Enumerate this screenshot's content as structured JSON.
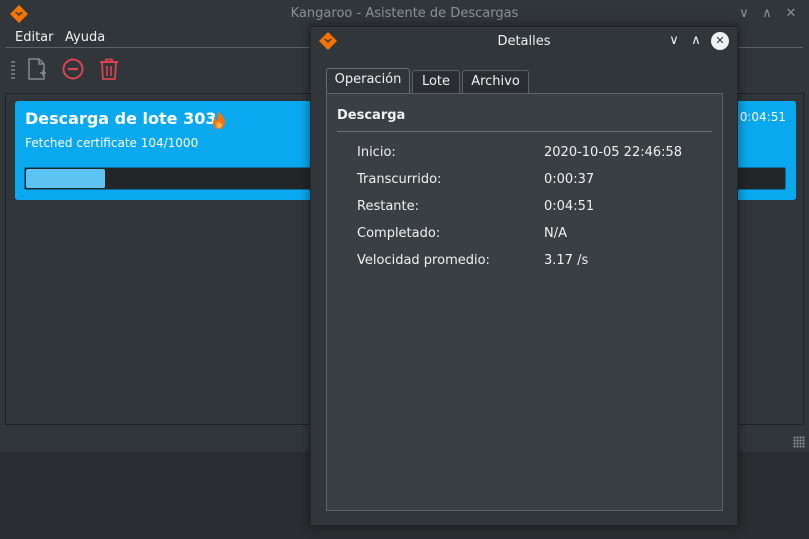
{
  "main_window": {
    "title": "Kangaroo - Asistente de Descargas",
    "menu": [
      "Editar",
      "Ayuda"
    ],
    "toolbar": {
      "new_icon": "new-file-icon",
      "stop_icon": "stop-circle-icon",
      "delete_icon": "trash-icon"
    },
    "job": {
      "title": "Descarga de lote 303",
      "status": "Fetched certificate 104/1000",
      "time": "0:04:51",
      "progress": 0.104,
      "icon": "flame-icon"
    }
  },
  "dialog": {
    "title": "Detalles",
    "tabs": [
      "Operación",
      "Lote",
      "Archivo"
    ],
    "active_tab": "Operación",
    "section": "Descarga",
    "rows": [
      {
        "key": "Inicio:",
        "value": "2020-10-05 22:46:58"
      },
      {
        "key": "Transcurrido:",
        "value": "0:00:37"
      },
      {
        "key": "Restante:",
        "value": "0:04:51"
      },
      {
        "key": "Completado:",
        "value": "N/A"
      },
      {
        "key": "Velocidad promedio:",
        "value": "3.17 /s"
      }
    ]
  },
  "colors": {
    "accent": "#0aa9ef",
    "window_bg": "#31363b",
    "danger": "#da4453",
    "brand": "#f67400"
  }
}
